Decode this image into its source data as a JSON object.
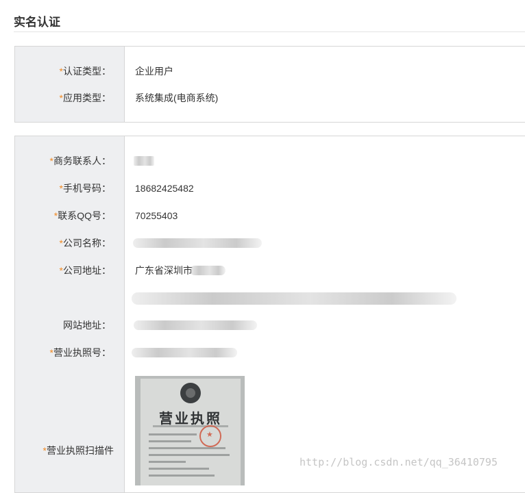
{
  "page": {
    "title": "实名认证"
  },
  "auth_section": {
    "auth_type": {
      "star": "*",
      "label": "认证类型：",
      "value": "企业用户"
    },
    "app_type": {
      "star": "*",
      "label": "应用类型：",
      "value": "系统集成(电商系统)"
    }
  },
  "company_section": {
    "contact": {
      "star": "*",
      "label": "商务联系人：",
      "value": ""
    },
    "phone": {
      "star": "*",
      "label": "手机号码：",
      "value": "18682425482"
    },
    "qq": {
      "star": "*",
      "label": "联系QQ号：",
      "value": "70255403"
    },
    "company_name": {
      "star": "*",
      "label": "公司名称：",
      "value": ""
    },
    "address": {
      "star": "*",
      "label": "公司地址：",
      "value": "广东省深圳市"
    },
    "website": {
      "label": "网站地址：",
      "value": ""
    },
    "license_no": {
      "star": "*",
      "label": "营业执照号：",
      "value": ""
    },
    "license_scan": {
      "star": "*",
      "label": "营业执照扫描件",
      "image_title": "营业执照"
    }
  },
  "watermark": "http://blog.csdn.net/qq_36410795"
}
